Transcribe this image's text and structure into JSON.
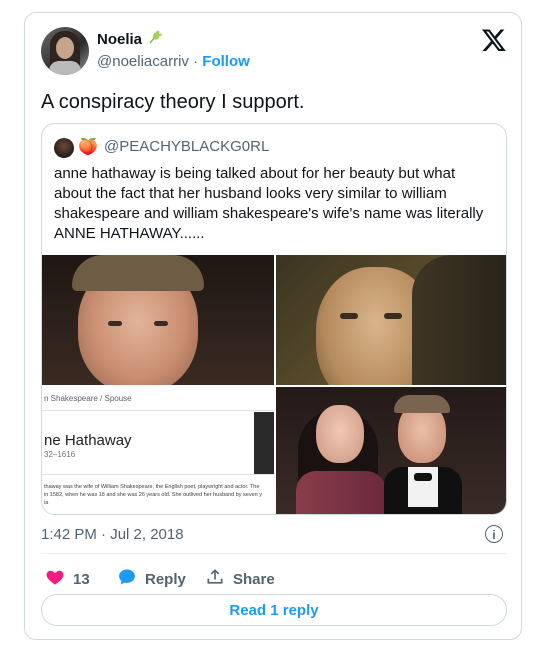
{
  "author": {
    "name": "Noelia",
    "badge_icon": "wheat-icon",
    "handle": "@noeliacarriv",
    "separator": "·",
    "follow_label": "Follow"
  },
  "tweet": {
    "text": "A conspiracy theory I support.",
    "timestamp": "1:42 PM · Jul 2, 2018"
  },
  "quote": {
    "emoji": "🍑",
    "handle": "@PEACHYBLACKG0RL",
    "text": "anne hathaway is being talked about for her beauty but what about the fact that her husband looks very similar to william shakespeare and william shakespeare's wife's name was literally ANNE HATHAWAY......",
    "screenshot": {
      "breadcrumb": "n Shakespeare / Spouse",
      "title": "ne Hathaway",
      "years": "32–1616",
      "line1": "thaway was the wife of William Shakespeare, the English poet, playwright and actor. The",
      "line2": "in 1582, when he was 18 and she was 26 years old. She outlived her husband by seven y",
      "line3": "ia"
    }
  },
  "actions": {
    "likes": "13",
    "reply_label": "Reply",
    "share_label": "Share",
    "read_replies_label": "Read 1 reply"
  },
  "colors": {
    "accent": "#1d9bf0",
    "like": "#f91880",
    "secondary_text": "#536471",
    "border": "#cfd9de"
  }
}
